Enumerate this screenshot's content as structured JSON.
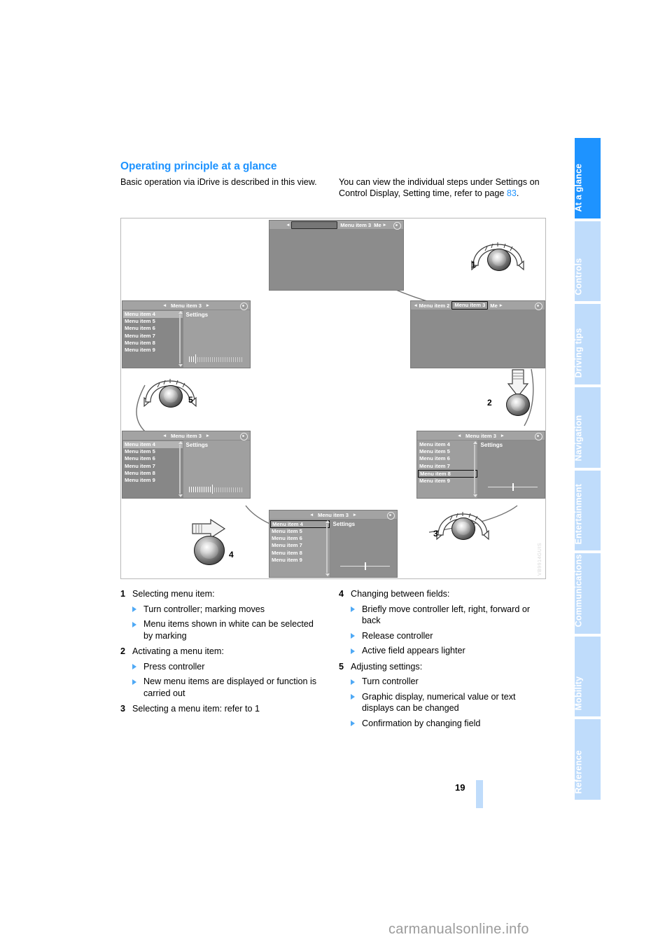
{
  "document": {
    "page_number": "19",
    "watermark": "carmanualsonline.info",
    "figure_code": "VB9914GUIS"
  },
  "heading": "Operating principle at a glance",
  "intro": {
    "left": "Basic operation via iDrive is described in this view.",
    "right_part1": "You can view the individual steps under Settings on Control Display, Setting time, refer to page ",
    "right_link": "83",
    "right_part2": "."
  },
  "sidebar": {
    "items": [
      {
        "label": "At a glance",
        "active": true
      },
      {
        "label": "Controls",
        "active": false
      },
      {
        "label": "Driving tips",
        "active": false
      },
      {
        "label": "Navigation",
        "active": false
      },
      {
        "label": "Entertainment",
        "active": false
      },
      {
        "label": "Communications",
        "active": false
      },
      {
        "label": "Mobility",
        "active": false
      },
      {
        "label": "Reference",
        "active": false
      }
    ]
  },
  "figure": {
    "screens": {
      "top_center": {
        "header_left_arrow": "◂",
        "header_title": "Menu item 3",
        "header_trailing": "Me",
        "header_right_arrow": "▸"
      },
      "mid_right": {
        "header_left_arrow": "◂",
        "header_prev": "Menu item 2",
        "header_selected": "Menu item 3",
        "header_trailing": "Me",
        "header_right_arrow": "▸"
      },
      "mid_left": {
        "header_title": "Menu item 3",
        "settings_title": "Settings",
        "menu_items": [
          "Menu item 4",
          "Menu item 5",
          "Menu item 6",
          "Menu item 7",
          "Menu item 8",
          "Menu item 9"
        ],
        "selected_index": 0,
        "control": "bargraph",
        "bargraph_filled": 3
      },
      "bottom_left": {
        "header_title": "Menu item 3",
        "settings_title": "Settings",
        "menu_items": [
          "Menu item 4",
          "Menu item 5",
          "Menu item 6",
          "Menu item 7",
          "Menu item 8",
          "Menu item 9"
        ],
        "selected_index": 0,
        "control": "bargraph",
        "bargraph_filled": 11
      },
      "bottom_center": {
        "header_title": "Menu item 3",
        "settings_title": "Settings",
        "menu_items": [
          "Menu item 4",
          "Menu item 5",
          "Menu item 6",
          "Menu item 7",
          "Menu item 8",
          "Menu item 9"
        ],
        "selected_index": 0,
        "control": "slider"
      },
      "bottom_right": {
        "header_title": "Menu item 3",
        "settings_title": "Settings",
        "menu_items": [
          "Menu item 4",
          "Menu item 5",
          "Menu item 6",
          "Menu item 7",
          "Menu item 8",
          "Menu item 9"
        ],
        "selected_index": 4,
        "control": "slider"
      }
    },
    "callouts": [
      {
        "number": "1",
        "action": "turn-controller"
      },
      {
        "number": "2",
        "action": "press-controller"
      },
      {
        "number": "3",
        "action": "turn-controller"
      },
      {
        "number": "4",
        "action": "move-controller"
      },
      {
        "number": "5",
        "action": "turn-controller"
      }
    ]
  },
  "steps_left": [
    {
      "number": "1",
      "title": "Selecting menu item:",
      "bullets": [
        "Turn controller; marking moves",
        "Menu items shown in white can be selected by marking"
      ]
    },
    {
      "number": "2",
      "title": "Activating a menu item:",
      "bullets": [
        "Press controller",
        "New menu items are displayed or function is carried out"
      ]
    },
    {
      "number": "3",
      "title": "Selecting a menu item: refer to 1",
      "bullets": []
    }
  ],
  "steps_right": [
    {
      "number": "4",
      "title": "Changing between fields:",
      "bullets": [
        "Briefly move controller left, right, forward or back",
        "Release controller",
        "Active field appears lighter"
      ]
    },
    {
      "number": "5",
      "title": "Adjusting settings:",
      "bullets": [
        "Turn controller",
        "Graphic display, numerical value or text displays can be changed",
        "Confirmation by changing field"
      ]
    }
  ]
}
